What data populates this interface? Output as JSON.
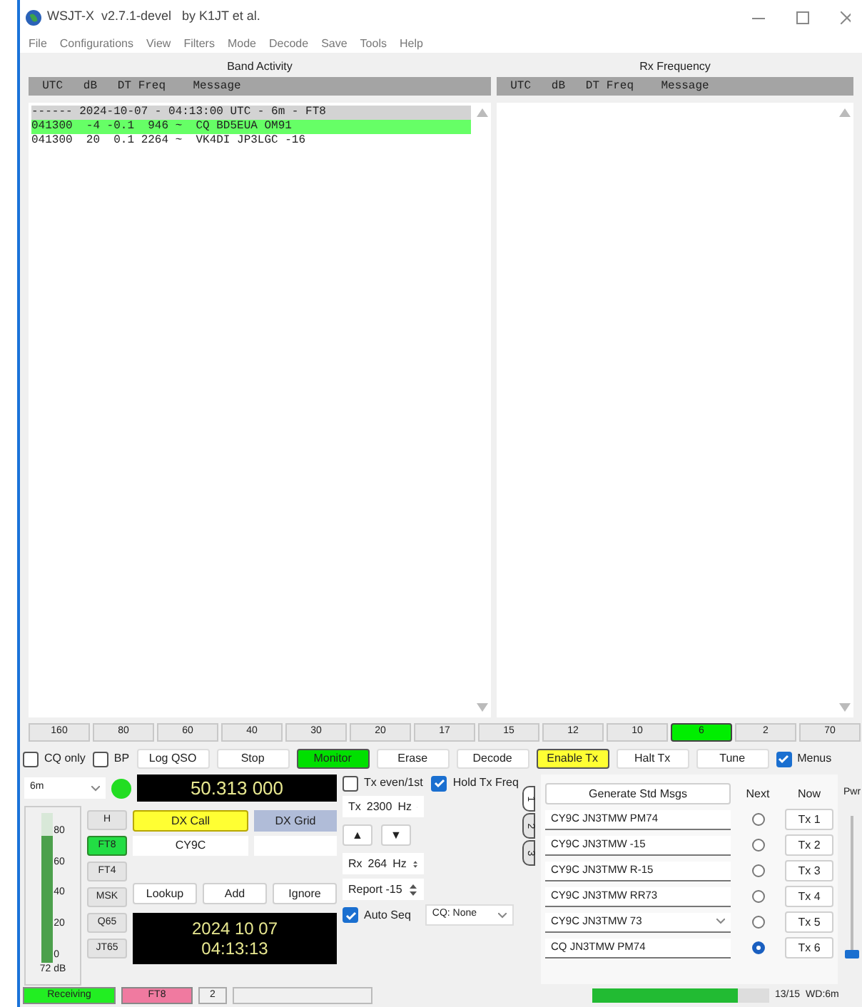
{
  "window": {
    "title": "WSJT-X  v2.7.1-devel   by K1JT et al."
  },
  "menu": [
    "File",
    "Configurations",
    "View",
    "Filters",
    "Mode",
    "Decode",
    "Save",
    "Tools",
    "Help"
  ],
  "band_activity": {
    "title": "Band Activity",
    "header": "  UTC   dB   DT Freq    Message",
    "lines": [
      {
        "kind": "separator",
        "text": "------ 2024-10-07 - 04:13:00 UTC - 6m - FT8"
      },
      {
        "kind": "cq",
        "text": "041300  -4 -0.1  946 ~  CQ BD5EUA OM91"
      },
      {
        "kind": "normal",
        "text": "041300  20  0.1 2264 ~  VK4DI JP3LGC -16"
      }
    ]
  },
  "rx_frequency": {
    "title": "Rx Frequency",
    "header": "  UTC   dB   DT Freq    Message"
  },
  "bands": [
    {
      "label": "160",
      "selected": false
    },
    {
      "label": "80",
      "selected": false
    },
    {
      "label": "60",
      "selected": false
    },
    {
      "label": "40",
      "selected": false
    },
    {
      "label": "30",
      "selected": false
    },
    {
      "label": "20",
      "selected": false
    },
    {
      "label": "17",
      "selected": false
    },
    {
      "label": "15",
      "selected": false
    },
    {
      "label": "12",
      "selected": false
    },
    {
      "label": "10",
      "selected": false
    },
    {
      "label": "6",
      "selected": true
    },
    {
      "label": "2",
      "selected": false
    },
    {
      "label": "70",
      "selected": false
    }
  ],
  "controls": [
    {
      "kind": "checkbox",
      "label": "CQ only",
      "checked": false
    },
    {
      "kind": "checkbox",
      "label": "BP",
      "checked": false
    },
    {
      "kind": "button",
      "label": "Log QSO",
      "on": false
    },
    {
      "kind": "button",
      "label": "Stop",
      "on": false
    },
    {
      "kind": "button",
      "label": "Monitor",
      "on": true,
      "color": "#00e000"
    },
    {
      "kind": "button",
      "label": "Erase",
      "on": false
    },
    {
      "kind": "button",
      "label": "Decode",
      "on": false
    },
    {
      "kind": "button",
      "label": "Enable Tx",
      "on": true,
      "color": "#ffff33"
    },
    {
      "kind": "button",
      "label": "Halt Tx",
      "on": false
    },
    {
      "kind": "button",
      "label": "Tune",
      "on": false
    },
    {
      "kind": "checkbox",
      "label": "Menus",
      "checked": true
    }
  ],
  "band_select": "6m",
  "frequency": "50.313 000",
  "meter": {
    "ticks": [
      "80",
      "60",
      "40",
      "20",
      "0"
    ],
    "level": 0.85,
    "reading": "72 dB"
  },
  "modes": [
    {
      "label": "H",
      "selected": false
    },
    {
      "label": "FT8",
      "selected": true
    },
    {
      "label": "FT4",
      "selected": false
    },
    {
      "label": "MSK",
      "selected": false
    },
    {
      "label": "Q65",
      "selected": false
    },
    {
      "label": "JT65",
      "selected": false
    }
  ],
  "dx_call": {
    "label": "DX Call",
    "value": "CY9C"
  },
  "dx_grid": {
    "label": "DX Grid"
  },
  "lookup_buttons": [
    "Lookup",
    "Add",
    "Ignore"
  ],
  "clock": {
    "date": "2024 10 07",
    "time": "04:13:13"
  },
  "tx_even": {
    "label": "Tx even/1st",
    "checked": false
  },
  "hold_tx_freq": {
    "label": "Hold Tx Freq",
    "checked": true
  },
  "tx_freq": {
    "prefix": "Tx",
    "value": "2300",
    "unit": "Hz"
  },
  "arrows": [
    "▲",
    "▼"
  ],
  "rx_freq": {
    "prefix": "Rx",
    "value": "264",
    "unit": "Hz"
  },
  "report": "Report -15",
  "auto_seq": {
    "label": "Auto Seq",
    "checked": true
  },
  "cq_select": "CQ: None",
  "tabs": [
    {
      "label": "1",
      "selected": true
    },
    {
      "label": "2",
      "selected": false
    },
    {
      "label": "3",
      "selected": false
    }
  ],
  "messages": {
    "generate": "Generate Std Msgs",
    "next_label": "Next",
    "now_label": "Now",
    "rows": [
      {
        "kind": "text",
        "text": "CY9C JN3TMW PM74",
        "selected": false,
        "button": "Tx 1"
      },
      {
        "kind": "text",
        "text": "CY9C JN3TMW -15",
        "selected": false,
        "button": "Tx 2"
      },
      {
        "kind": "text",
        "text": "CY9C JN3TMW R-15",
        "selected": false,
        "button": "Tx 3"
      },
      {
        "kind": "text",
        "text": "CY9C JN3TMW RR73",
        "selected": false,
        "button": "Tx 4"
      },
      {
        "kind": "dropdown",
        "text": "CY9C JN3TMW 73",
        "selected": false,
        "button": "Tx 5"
      },
      {
        "kind": "text",
        "text": "CQ JN3TMW PM74",
        "selected": true,
        "button": "Tx 6"
      }
    ]
  },
  "power": {
    "label": "Pwr",
    "level": 0
  },
  "status_bar": {
    "state": "Receiving",
    "mode": "FT8",
    "count": "2",
    "progress": {
      "level": 0.82
    },
    "period": "13/15",
    "wd": "WD:6m"
  }
}
